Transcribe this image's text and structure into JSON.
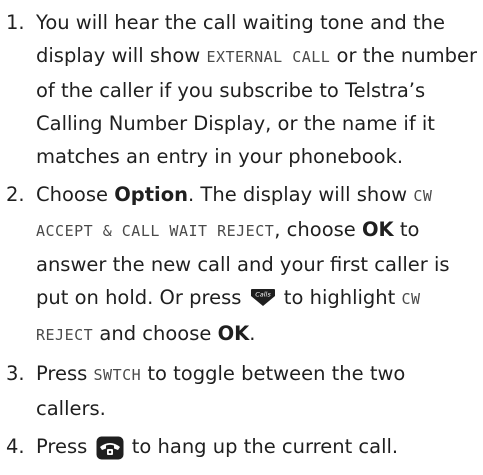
{
  "steps": [
    {
      "number": "1.",
      "text_a": "You will hear the call waiting tone and the display will show ",
      "display_a": "EXTERNAL CALL",
      "text_b": " or the number of the caller if you subscribe to Telstra’s Calling Number Display, or the name if it matches an entry in your phonebook."
    },
    {
      "number": "2.",
      "text_a": "Choose ",
      "bold_a": "Option",
      "text_b": ". The display will show ",
      "display_a": "CW ACCEPT & CALL WAIT REJECT",
      "text_c": ", choose ",
      "bold_b": "OK",
      "text_d": " to answer the new call and your first caller is put on hold. Or press ",
      "icon": "calls-key-icon",
      "icon_label": "Calls",
      "text_e": " to highlight ",
      "display_b": "CW REJECT",
      "text_f": " and choose ",
      "bold_c": "OK",
      "text_g": "."
    },
    {
      "number": "3.",
      "text_a": "Press ",
      "display_a": "SWTCH",
      "text_b": " to toggle between the two callers."
    },
    {
      "number": "4.",
      "text_a": "Press ",
      "icon": "hang-up-key-icon",
      "text_b": " to hang up the current call."
    }
  ]
}
